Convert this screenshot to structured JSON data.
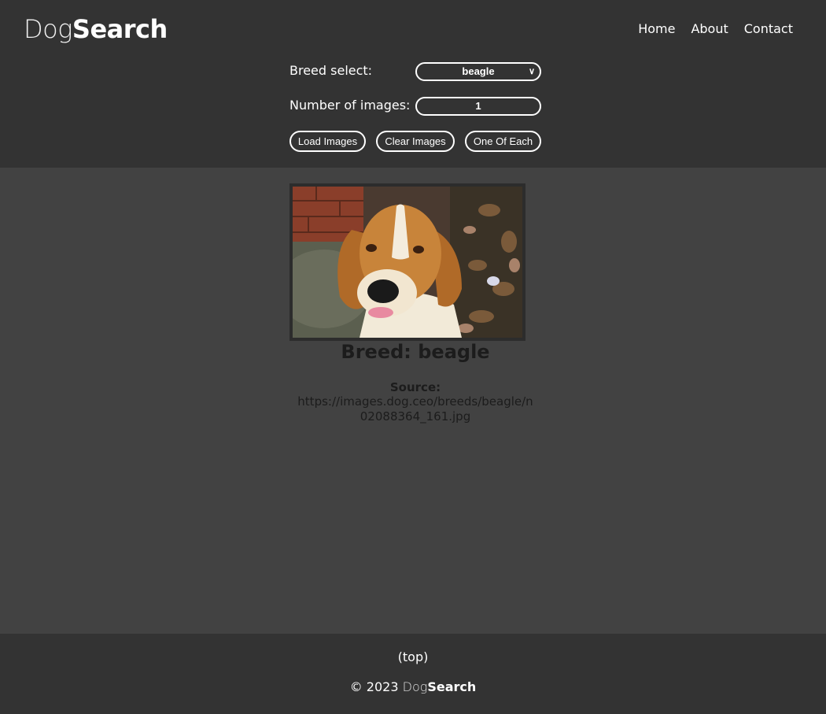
{
  "header": {
    "logo_light": "Dog",
    "logo_bold": "Search",
    "nav": [
      "Home",
      "About",
      "Contact"
    ]
  },
  "controls": {
    "breed_label": "Breed select:",
    "breed_value": "beagle",
    "count_label": "Number of images:",
    "count_value": "1",
    "buttons": [
      "Load Images",
      "Clear Images",
      "One Of Each"
    ]
  },
  "card": {
    "breed_title": "Breed: beagle",
    "source_label": "Source:",
    "source_url": "https://images.dog.ceo/breeds/beagle/n02088364_161.jpg"
  },
  "footer": {
    "top_link": "(top)",
    "copyright_prefix": "© 2023",
    "logo_light": "Dog",
    "logo_bold": "Search"
  },
  "colors": {
    "header_bg": "#333333",
    "body_bg": "#424242",
    "text": "#ffffff",
    "card_text": "#1c1c1c"
  },
  "icons": {
    "select_arrow": "chevron-down-icon"
  }
}
